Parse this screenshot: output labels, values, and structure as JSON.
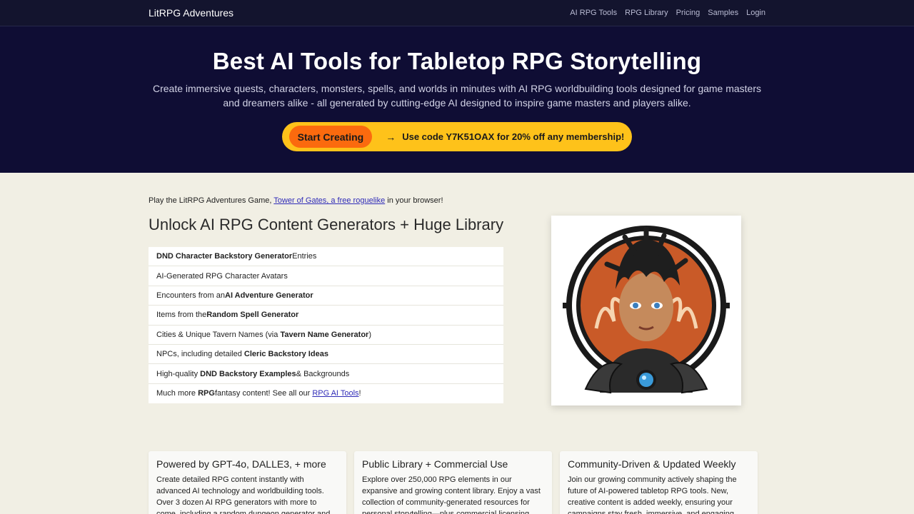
{
  "nav": {
    "brand": "LitRPG Adventures",
    "links": [
      "AI RPG Tools",
      "RPG Library",
      "Pricing",
      "Samples",
      "Login"
    ]
  },
  "hero": {
    "title": "Best AI Tools for Tabletop RPG Storytelling",
    "subtitle": "Create immersive quests, characters, monsters, spells, and worlds in minutes with AI RPG worldbuilding tools designed for game masters and dreamers alike - all generated by cutting-edge AI designed to inspire game masters and players alike.",
    "cta_label": "Start Creating",
    "cta_arrow": "→",
    "cta_code_text": "Use code Y7K51OAX for 20% off any membership!"
  },
  "intro": {
    "before": "Play the LitRPG Adventures Game, ",
    "link": "Tower of Gates, a free roguelike",
    "after": " in your browser!"
  },
  "section_title": "Unlock AI RPG Content Generators + Huge Library",
  "features": [
    {
      "pre": "",
      "bold": "DND Character Backstory Generator",
      "post": " Entries"
    },
    {
      "pre": "AI-Generated RPG Character Avatars",
      "bold": "",
      "post": ""
    },
    {
      "pre": "Encounters from an ",
      "bold": "AI Adventure Generator",
      "post": ""
    },
    {
      "pre": "Items from the ",
      "bold": "Random Spell Generator",
      "post": ""
    },
    {
      "pre": "Cities & Unique Tavern Names (via ",
      "bold": "Tavern Name Generator",
      "post": ")"
    },
    {
      "pre": "NPCs, including detailed ",
      "bold": "Cleric Backstory Ideas",
      "post": ""
    },
    {
      "pre": "High-quality ",
      "bold": "DND Backstory Examples",
      "post": " & Backgrounds"
    },
    {
      "pre": "Much more ",
      "bold": "RPG",
      "post": " fantasy content! See all our ",
      "link": "RPG AI Tools",
      "end": "!"
    }
  ],
  "cards": [
    {
      "title": "Powered by GPT-4o, DALLE3, + more",
      "text": "Create detailed RPG content instantly with advanced AI technology and worldbuilding tools. Over 3 dozen AI RPG generators with more to come, including a random dungeon generator and hex worldbuilder that"
    },
    {
      "title": "Public Library + Commercial Use",
      "text": "Explore over 250,000 RPG elements in our expansive and growing content library. Enjoy a vast collection of community-generated resources for personal storytelling—plus commercial licensing options"
    },
    {
      "title": "Community-Driven & Updated Weekly",
      "text": "Join our growing community actively shaping the future of AI-powered tabletop RPG tools. New, creative content is added weekly, ensuring your campaigns stay fresh, immersive, and engaging"
    }
  ],
  "colors": {
    "nav_bg": "#13142e",
    "hero_bg": "#0f0d34",
    "page_bg": "#f1efe4",
    "cta_outer": "#fec21a",
    "cta_inner": "#fb6a0e",
    "link": "#2f2bb7"
  },
  "portrait_icon": "character-portrait-icon"
}
